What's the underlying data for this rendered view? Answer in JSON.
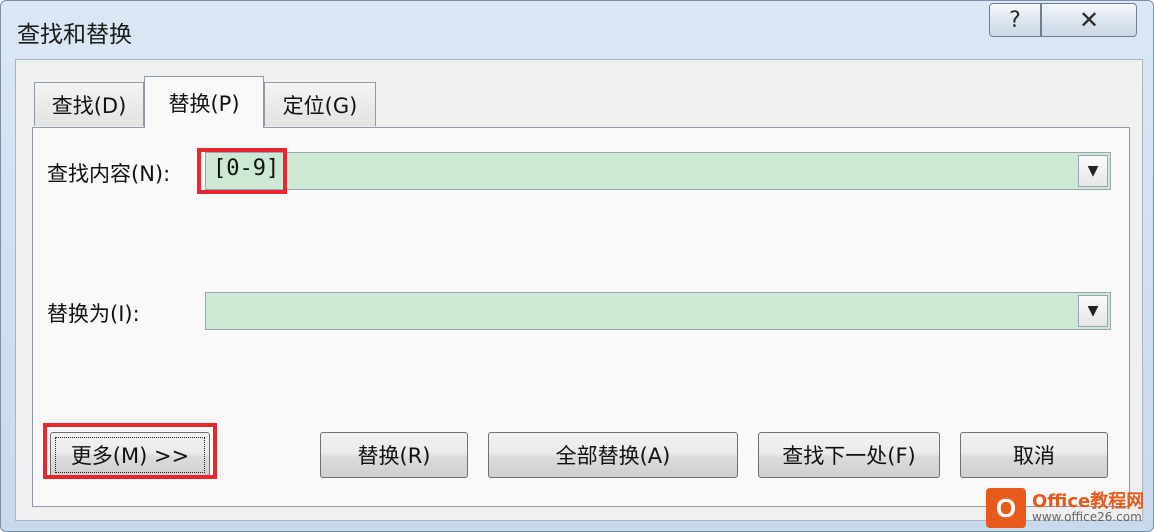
{
  "window": {
    "title": "查找和替换",
    "help_label": "?",
    "close_label": "✕"
  },
  "tabs": [
    {
      "label": "查找(D)",
      "active": false
    },
    {
      "label": "替换(P)",
      "active": true
    },
    {
      "label": "定位(G)",
      "active": false
    }
  ],
  "find": {
    "label": "查找内容(N):",
    "value": "[0-9]"
  },
  "replace": {
    "label": "替换为(I):",
    "value": ""
  },
  "buttons": {
    "more": "更多(M) >>",
    "replace": "替换(R)",
    "replace_all": "全部替换(A)",
    "find_next": "查找下一处(F)",
    "cancel": "取消"
  },
  "watermark": {
    "icon": "O",
    "brand": "Office教程网",
    "url": "www.office26.com"
  },
  "colors": {
    "field_bg": "#cde8d3",
    "highlight": "#e8262b",
    "brand": "#e8591c"
  }
}
